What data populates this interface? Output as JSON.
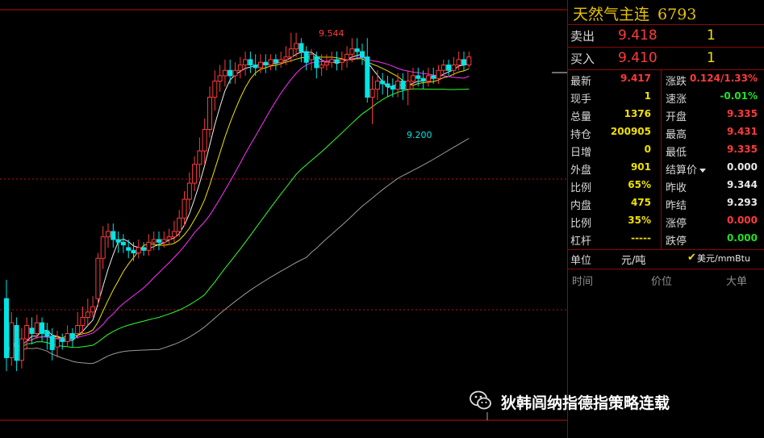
{
  "instrument": {
    "name": "天然气主连",
    "code": "6793"
  },
  "order_book": {
    "sell": {
      "label": "卖出",
      "price": "9.418",
      "qty": "1"
    },
    "buy": {
      "label": "买入",
      "price": "9.410",
      "qty": "1"
    }
  },
  "quote": [
    {
      "l1": "最新",
      "v1": "9.417",
      "c1": "red",
      "l2": "涨跌",
      "v2": "0.124/1.33%",
      "c2": "red"
    },
    {
      "l1": "现手",
      "v1": "1",
      "c1": "yel",
      "l2": "速涨",
      "v2": "-0.01%",
      "c2": "grn"
    },
    {
      "l1": "总量",
      "v1": "1376",
      "c1": "yel",
      "l2": "开盘",
      "v2": "9.335",
      "c2": "red"
    },
    {
      "l1": "持仓",
      "v1": "200905",
      "c1": "yel",
      "l2": "最高",
      "v2": "9.431",
      "c2": "red"
    },
    {
      "l1": "日增",
      "v1": "0",
      "c1": "yel",
      "l2": "最低",
      "v2": "9.335",
      "c2": "red"
    },
    {
      "l1": "外盘",
      "v1": "901",
      "c1": "yel",
      "l2": "结算价",
      "v2": "0.000",
      "c2": "wht"
    },
    {
      "l1": "比例",
      "v1": "65%",
      "c1": "yel",
      "l2": "昨收",
      "v2": "9.344",
      "c2": "wht"
    },
    {
      "l1": "内盘",
      "v1": "475",
      "c1": "yel",
      "l2": "昨结",
      "v2": "9.293",
      "c2": "wht"
    },
    {
      "l1": "比例",
      "v1": "35%",
      "c1": "yel",
      "l2": "涨停",
      "v2": "0.000",
      "c2": "red"
    },
    {
      "l1": "杠杆",
      "v1": "-----",
      "c1": "yel",
      "l2": "跌停",
      "v2": "0.000",
      "c2": "grn"
    }
  ],
  "unit": {
    "label": "单位",
    "value": "元/吨",
    "alt_value": "美元/mmBtu"
  },
  "tick_headers": {
    "time": "时间",
    "price": "价位",
    "big": "大单"
  },
  "watermark": "狄韩闾纳指德指策略连载",
  "chart_data": {
    "type": "candlestick",
    "annotations": {
      "high": "9.544",
      "low": "9.200"
    },
    "y_range": [
      8.1,
      9.62
    ],
    "colors": {
      "up": "#ff3b3b",
      "down": "#00e5e5",
      "ma5": "#f0f0f0",
      "ma10": "#f0e000",
      "ma20": "#ff30ff",
      "ma40": "#30ff30",
      "ma60": "#9a9a9a",
      "grid": "#c01010"
    },
    "candles": [
      [
        8.55,
        8.33,
        8.62,
        8.28
      ],
      [
        8.33,
        8.46,
        8.5,
        8.3
      ],
      [
        8.45,
        8.32,
        8.48,
        8.28
      ],
      [
        8.32,
        8.4,
        8.44,
        8.29
      ],
      [
        8.4,
        8.45,
        8.48,
        8.36
      ],
      [
        8.44,
        8.42,
        8.48,
        8.38
      ],
      [
        8.42,
        8.46,
        8.49,
        8.4
      ],
      [
        8.46,
        8.42,
        8.48,
        8.39
      ],
      [
        8.43,
        8.41,
        8.46,
        8.36
      ],
      [
        8.41,
        8.36,
        8.44,
        8.32
      ],
      [
        8.37,
        8.4,
        8.43,
        8.33
      ],
      [
        8.4,
        8.39,
        8.42,
        8.36
      ],
      [
        8.39,
        8.42,
        8.45,
        8.37
      ],
      [
        8.42,
        8.4,
        8.44,
        8.37
      ],
      [
        8.42,
        8.45,
        8.5,
        8.4
      ],
      [
        8.45,
        8.48,
        8.52,
        8.42
      ],
      [
        8.48,
        8.5,
        8.55,
        8.45
      ],
      [
        8.5,
        8.52,
        8.56,
        8.48
      ],
      [
        8.55,
        8.7,
        8.72,
        8.52
      ],
      [
        8.7,
        8.78,
        8.82,
        8.66
      ],
      [
        8.78,
        8.8,
        8.83,
        8.74
      ],
      [
        8.8,
        8.77,
        8.83,
        8.74
      ],
      [
        8.77,
        8.76,
        8.8,
        8.72
      ],
      [
        8.76,
        8.75,
        8.79,
        8.72
      ],
      [
        8.74,
        8.73,
        8.77,
        8.7
      ],
      [
        8.73,
        8.72,
        8.76,
        8.69
      ],
      [
        8.72,
        8.74,
        8.77,
        8.7
      ],
      [
        8.74,
        8.73,
        8.76,
        8.71
      ],
      [
        8.73,
        8.76,
        8.79,
        8.71
      ],
      [
        8.76,
        8.77,
        8.8,
        8.73
      ],
      [
        8.77,
        8.76,
        8.8,
        8.73
      ],
      [
        8.76,
        8.77,
        8.8,
        8.74
      ],
      [
        8.77,
        8.78,
        8.81,
        8.75
      ],
      [
        8.78,
        8.8,
        8.84,
        8.76
      ],
      [
        8.8,
        8.85,
        8.88,
        8.78
      ],
      [
        8.85,
        8.92,
        8.95,
        8.82
      ],
      [
        8.92,
        8.98,
        9.02,
        8.88
      ],
      [
        8.98,
        9.05,
        9.08,
        8.95
      ],
      [
        9.05,
        9.1,
        9.15,
        9.0
      ],
      [
        9.1,
        9.18,
        9.22,
        9.05
      ],
      [
        9.18,
        9.3,
        9.34,
        9.15
      ],
      [
        9.3,
        9.36,
        9.4,
        9.25
      ],
      [
        9.36,
        9.38,
        9.42,
        9.32
      ],
      [
        9.38,
        9.4,
        9.44,
        9.34
      ],
      [
        9.4,
        9.38,
        9.44,
        9.35
      ],
      [
        9.38,
        9.4,
        9.43,
        9.35
      ],
      [
        9.4,
        9.42,
        9.45,
        9.37
      ],
      [
        9.42,
        9.44,
        9.47,
        9.38
      ],
      [
        9.44,
        9.42,
        9.47,
        9.39
      ],
      [
        9.42,
        9.41,
        9.46,
        9.38
      ],
      [
        9.41,
        9.43,
        9.46,
        9.39
      ],
      [
        9.43,
        9.42,
        9.46,
        9.39
      ],
      [
        9.42,
        9.44,
        9.46,
        9.4
      ],
      [
        9.44,
        9.43,
        9.46,
        9.4
      ],
      [
        9.43,
        9.44,
        9.47,
        9.41
      ],
      [
        9.44,
        9.45,
        9.49,
        9.42
      ],
      [
        9.45,
        9.48,
        9.54,
        9.43
      ],
      [
        9.48,
        9.5,
        9.54,
        9.45
      ],
      [
        9.5,
        9.47,
        9.52,
        9.43
      ],
      [
        9.47,
        9.43,
        9.49,
        9.4
      ],
      [
        9.44,
        9.46,
        9.48,
        9.4
      ],
      [
        9.45,
        9.41,
        9.47,
        9.37
      ],
      [
        9.41,
        9.42,
        9.46,
        9.38
      ],
      [
        9.42,
        9.43,
        9.46,
        9.4
      ],
      [
        9.43,
        9.44,
        9.47,
        9.41
      ],
      [
        9.44,
        9.43,
        9.47,
        9.4
      ],
      [
        9.43,
        9.44,
        9.47,
        9.4
      ],
      [
        9.44,
        9.46,
        9.49,
        9.41
      ],
      [
        9.46,
        9.48,
        9.52,
        9.43
      ],
      [
        9.48,
        9.47,
        9.52,
        9.44
      ],
      [
        9.47,
        9.45,
        9.5,
        9.42
      ],
      [
        9.45,
        9.3,
        9.52,
        9.28
      ],
      [
        9.3,
        9.33,
        9.38,
        9.2
      ],
      [
        9.33,
        9.36,
        9.4,
        9.29
      ],
      [
        9.36,
        9.35,
        9.39,
        9.31
      ],
      [
        9.35,
        9.34,
        9.38,
        9.3
      ],
      [
        9.34,
        9.33,
        9.37,
        9.3
      ],
      [
        9.33,
        9.36,
        9.39,
        9.3
      ],
      [
        9.36,
        9.33,
        9.39,
        9.29
      ],
      [
        9.33,
        9.36,
        9.4,
        9.27
      ],
      [
        9.36,
        9.38,
        9.41,
        9.33
      ],
      [
        9.38,
        9.37,
        9.41,
        9.34
      ],
      [
        9.37,
        9.36,
        9.4,
        9.33
      ],
      [
        9.36,
        9.38,
        9.41,
        9.34
      ],
      [
        9.38,
        9.37,
        9.41,
        9.35
      ],
      [
        9.37,
        9.4,
        9.42,
        9.35
      ],
      [
        9.4,
        9.42,
        9.44,
        9.38
      ],
      [
        9.42,
        9.4,
        9.44,
        9.38
      ],
      [
        9.4,
        9.42,
        9.45,
        9.38
      ],
      [
        9.42,
        9.44,
        9.47,
        9.4
      ],
      [
        9.44,
        9.42,
        9.47,
        9.4
      ],
      [
        9.42,
        9.45,
        9.47,
        9.41
      ]
    ]
  }
}
